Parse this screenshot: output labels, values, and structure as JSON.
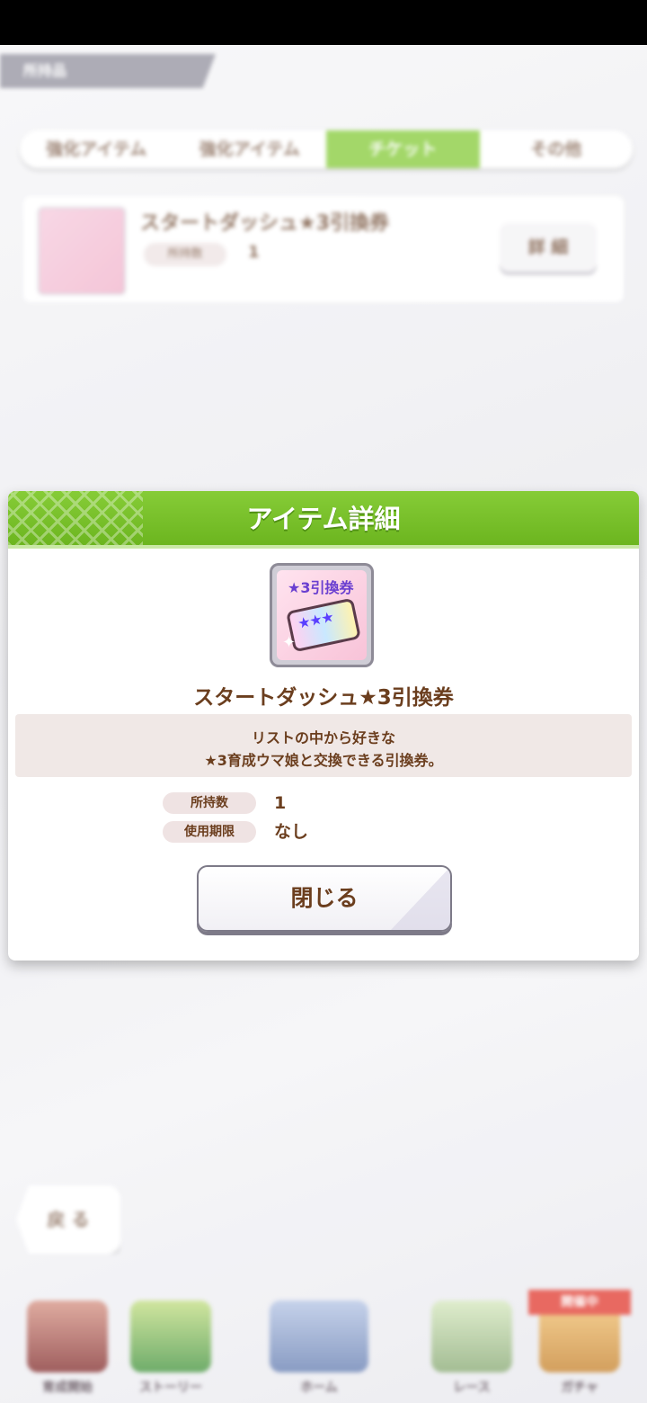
{
  "background": {
    "screen_label": "所持品",
    "tabs": [
      {
        "label": "強化アイテム"
      },
      {
        "label": "強化アイテム"
      },
      {
        "label": "チケット"
      },
      {
        "label": "その他"
      }
    ],
    "row": {
      "title": "スタートダッシュ★3引換券",
      "pill": "所持数",
      "count": "1",
      "button": "詳 細"
    },
    "back_button": "戻 る",
    "nav": [
      {
        "label": "育成開始",
        "icon": "character-icon"
      },
      {
        "label": "ストーリー",
        "icon": "book-icon"
      },
      {
        "label": "ホーム",
        "icon": "school-building-icon"
      },
      {
        "label": "レース",
        "icon": "race-track-icon"
      },
      {
        "label": "ガチャ",
        "icon": "gacha-icon"
      }
    ],
    "nav_badge": "開催中"
  },
  "dialog": {
    "title": "アイテム詳細",
    "item_name": "スタートダッシュ★3引換券",
    "icon": {
      "stamp": "★3引換券",
      "stars": "★★★"
    },
    "description": [
      "リストの中から好きな",
      "★3育成ウマ娘と交換できる引換券。"
    ],
    "info": [
      {
        "label": "所持数",
        "value": "1"
      },
      {
        "label": "使用期限",
        "value": "なし"
      }
    ],
    "close_label": "閉じる"
  },
  "colors": {
    "header_green": "#7cc22c",
    "active_tab": "#8fcf48",
    "text_brown": "#6b3e1e",
    "button_border": "#7d7a88"
  }
}
